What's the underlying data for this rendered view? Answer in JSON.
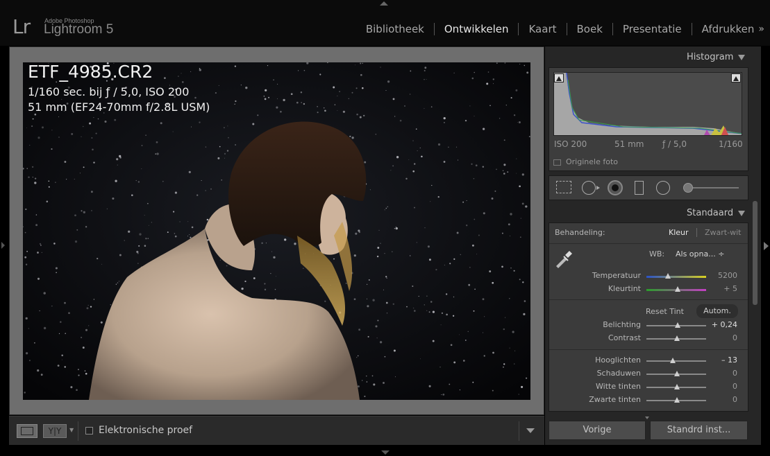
{
  "app": {
    "logo": "Lr",
    "vendor": "Adobe Photoshop",
    "product": "Lightroom 5"
  },
  "modules": [
    {
      "label": "Bibliotheek",
      "active": false
    },
    {
      "label": "Ontwikkelen",
      "active": true
    },
    {
      "label": "Kaart",
      "active": false
    },
    {
      "label": "Boek",
      "active": false
    },
    {
      "label": "Presentatie",
      "active": false
    },
    {
      "label": "Afdrukken",
      "active": false
    }
  ],
  "modules_more": "»",
  "photo_info": {
    "filename": "ETF_4985.CR2",
    "exposure": "1/160 sec. bij ƒ / 5,0, ISO 200",
    "lens": "51 mm (EF24-70mm f/2.8L USM)"
  },
  "toolbar": {
    "yy_label": "Y|Y",
    "proof_label": "Elektronische proef",
    "proof_checked": false
  },
  "histogram": {
    "title": "Histogram",
    "iso": "ISO 200",
    "focal": "51 mm",
    "aperture": "ƒ / 5,0",
    "shutter": "1/160",
    "original_photo_label": "Originele foto"
  },
  "tools": [
    "crop-icon",
    "spot-removal-icon",
    "red-eye-icon",
    "graduated-filter-icon",
    "radial-filter-icon",
    "adjustment-brush-icon"
  ],
  "basic": {
    "preset_label": "Standaard",
    "treatment_label": "Behandeling:",
    "treatment_color": "Kleur",
    "treatment_bw": "Zwart-wit",
    "wb_label": "WB:",
    "wb_value": "Als opna... ÷",
    "sliders_wb": [
      {
        "label": "Temperatuur",
        "value": "5200",
        "pos": 0.36
      },
      {
        "label": "Kleurtint",
        "value": "+ 5",
        "pos": 0.52
      }
    ],
    "reset_tint": "Reset Tint",
    "auto": "Autom.",
    "sliders_tone": [
      {
        "label": "Belichting",
        "value": "+ 0,24",
        "pos": 0.52,
        "bright": true
      },
      {
        "label": "Contrast",
        "value": "0",
        "pos": 0.5,
        "bright": false
      }
    ],
    "sliders_presence": [
      {
        "label": "Hooglichten",
        "value": "– 13",
        "pos": 0.44,
        "bright": true
      },
      {
        "label": "Schaduwen",
        "value": "0",
        "pos": 0.5,
        "bright": false
      },
      {
        "label": "Witte tinten",
        "value": "0",
        "pos": 0.5,
        "bright": false
      },
      {
        "label": "Zwarte tinten",
        "value": "0",
        "pos": 0.5,
        "bright": false
      }
    ]
  },
  "buttons": {
    "previous": "Vorige",
    "default": "Standrd inst..."
  },
  "colors": {
    "accent_active": "#e6e6e6",
    "panel_bg": "#262626",
    "section_bg": "#3b3b3b"
  }
}
